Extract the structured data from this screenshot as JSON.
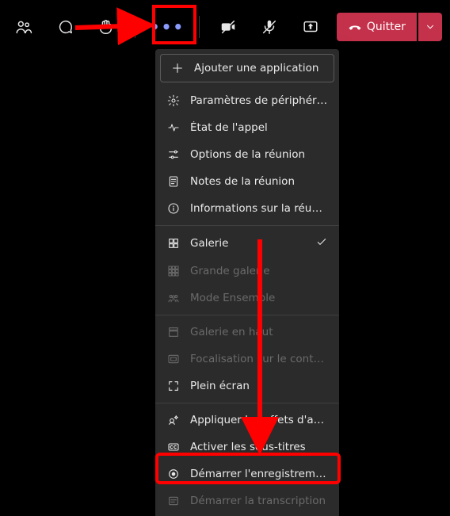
{
  "toolbar": {
    "participants_icon": "participants-icon",
    "chat_icon": "chat-icon",
    "raise_hand_icon": "raise-hand-icon",
    "more_icon": "more-icon",
    "camera_icon": "camera-off-icon",
    "mic_icon": "mic-off-icon",
    "share_icon": "share-icon",
    "leave_label": "Quitter",
    "leave_icon": "hangup-icon",
    "leave_caret_icon": "chevron-down-icon"
  },
  "menu": {
    "add_app": "Ajouter une application",
    "section1": [
      {
        "icon": "settings-icon",
        "label": "Paramètres de périphérique"
      },
      {
        "icon": "pulse-icon",
        "label": "État de l'appel"
      },
      {
        "icon": "sliders-icon",
        "label": "Options de la réunion"
      },
      {
        "icon": "notes-icon",
        "label": "Notes de la réunion"
      },
      {
        "icon": "info-icon",
        "label": "Informations sur la réunion"
      }
    ],
    "section2": [
      {
        "icon": "grid-icon",
        "label": "Galerie",
        "checked": true,
        "disabled": false
      },
      {
        "icon": "grid9-icon",
        "label": "Grande galerie",
        "checked": false,
        "disabled": true
      },
      {
        "icon": "together-icon",
        "label": "Mode Ensemble",
        "checked": false,
        "disabled": true
      }
    ],
    "section3": [
      {
        "icon": "gallerytop-icon",
        "label": "Galerie en haut",
        "disabled": true
      },
      {
        "icon": "focus-icon",
        "label": "Focalisation sur le contenu",
        "disabled": true
      },
      {
        "icon": "fullscreen-icon",
        "label": "Plein écran",
        "disabled": false
      }
    ],
    "section4": [
      {
        "icon": "sparkle-icon",
        "label": "Appliquer les effets d'arri...",
        "disabled": false
      },
      {
        "icon": "cc-icon",
        "label": "Activer les sous-titres",
        "disabled": false
      },
      {
        "icon": "record-icon",
        "label": "Démarrer l'enregistrement",
        "disabled": false
      },
      {
        "icon": "transcript-icon",
        "label": "Démarrer la transcription",
        "disabled": true
      }
    ]
  },
  "annotations": {
    "highlight_more": true,
    "highlight_record": true,
    "arrow_to_more": true,
    "arrow_to_record": true
  }
}
